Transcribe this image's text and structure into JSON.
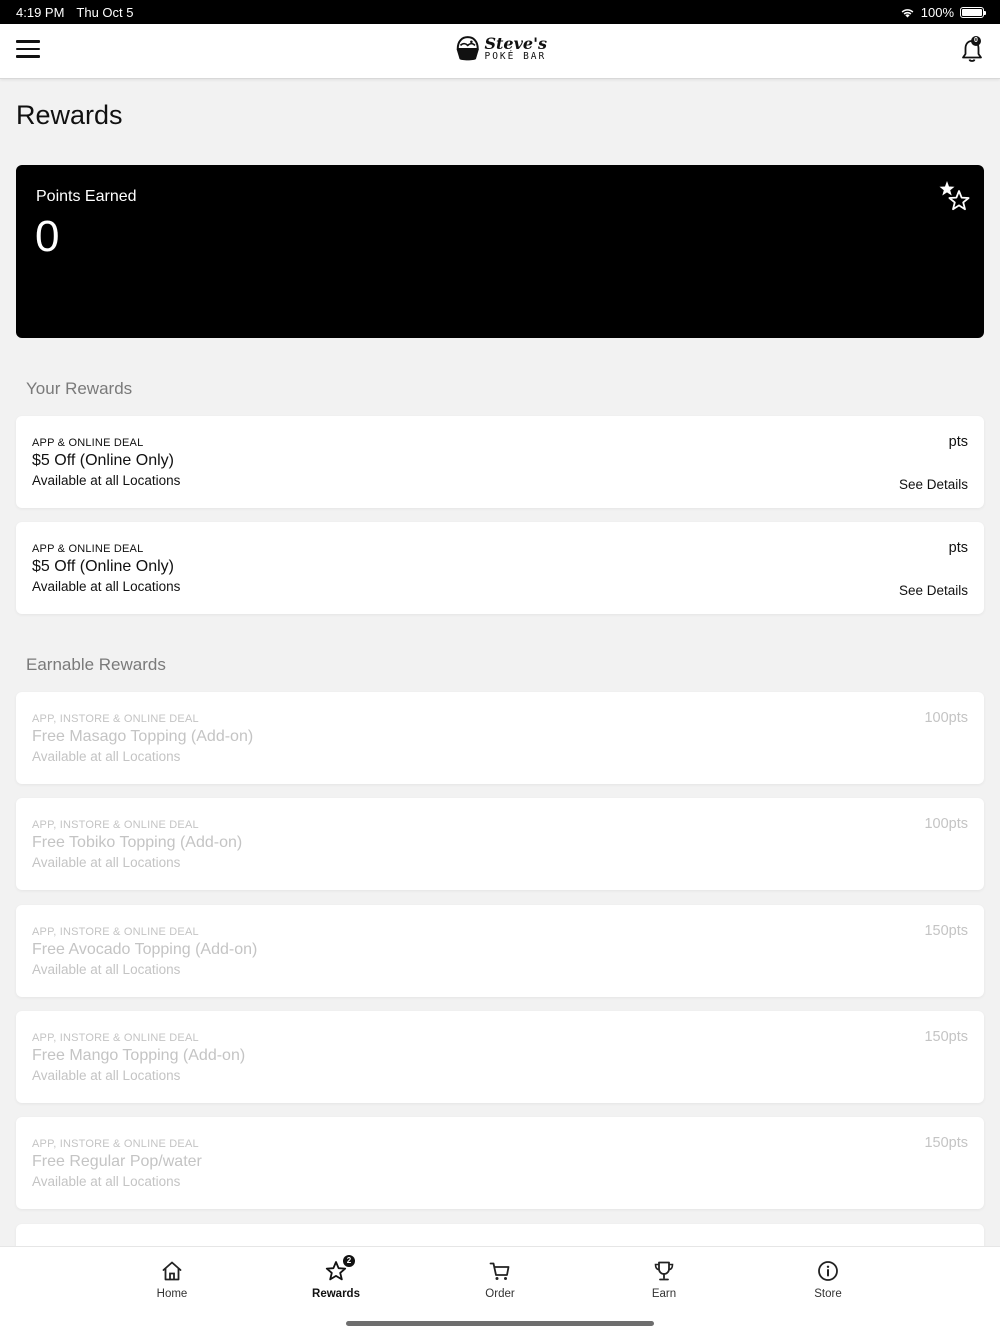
{
  "status_bar": {
    "time": "4:19 PM",
    "date": "Thu Oct 5",
    "battery": "100%",
    "wifi_icon": "wifi-icon"
  },
  "header": {
    "logo_line1": "Steve's",
    "logo_line2": "POKÉ BAR",
    "notification_count": "0"
  },
  "page": {
    "title": "Rewards"
  },
  "points_card": {
    "label": "Points Earned",
    "value": "0"
  },
  "your_rewards": {
    "title": "Your Rewards",
    "items": [
      {
        "type": "APP & ONLINE DEAL",
        "name": "$5 Off (Online Only)",
        "availability": "Available at all Locations",
        "points": "pts",
        "details_label": "See Details"
      },
      {
        "type": "APP & ONLINE DEAL",
        "name": "$5 Off (Online Only)",
        "availability": "Available at all Locations",
        "points": "pts",
        "details_label": "See Details"
      }
    ]
  },
  "earnable_rewards": {
    "title": "Earnable Rewards",
    "items": [
      {
        "type": "APP, INSTORE & ONLINE DEAL",
        "name": "Free Masago Topping (Add-on)",
        "availability": "Available at all Locations",
        "points": "100pts"
      },
      {
        "type": "APP, INSTORE & ONLINE DEAL",
        "name": "Free Tobiko Topping (Add-on)",
        "availability": "Available at all Locations",
        "points": "100pts"
      },
      {
        "type": "APP, INSTORE & ONLINE DEAL",
        "name": "Free Avocado Topping (Add-on)",
        "availability": "Available at all Locations",
        "points": "150pts"
      },
      {
        "type": "APP, INSTORE & ONLINE DEAL",
        "name": "Free Mango Topping (Add-on)",
        "availability": "Available at all Locations",
        "points": "150pts"
      },
      {
        "type": "APP, INSTORE & ONLINE DEAL",
        "name": "Free Regular Pop/water",
        "availability": "Available at all Locations",
        "points": "150pts"
      }
    ]
  },
  "tab_bar": {
    "items": [
      {
        "label": "Home",
        "icon": "home-icon"
      },
      {
        "label": "Rewards",
        "icon": "star-icon",
        "badge": "2"
      },
      {
        "label": "Order",
        "icon": "cart-icon"
      },
      {
        "label": "Earn",
        "icon": "trophy-icon"
      },
      {
        "label": "Store",
        "icon": "info-icon"
      }
    ]
  }
}
